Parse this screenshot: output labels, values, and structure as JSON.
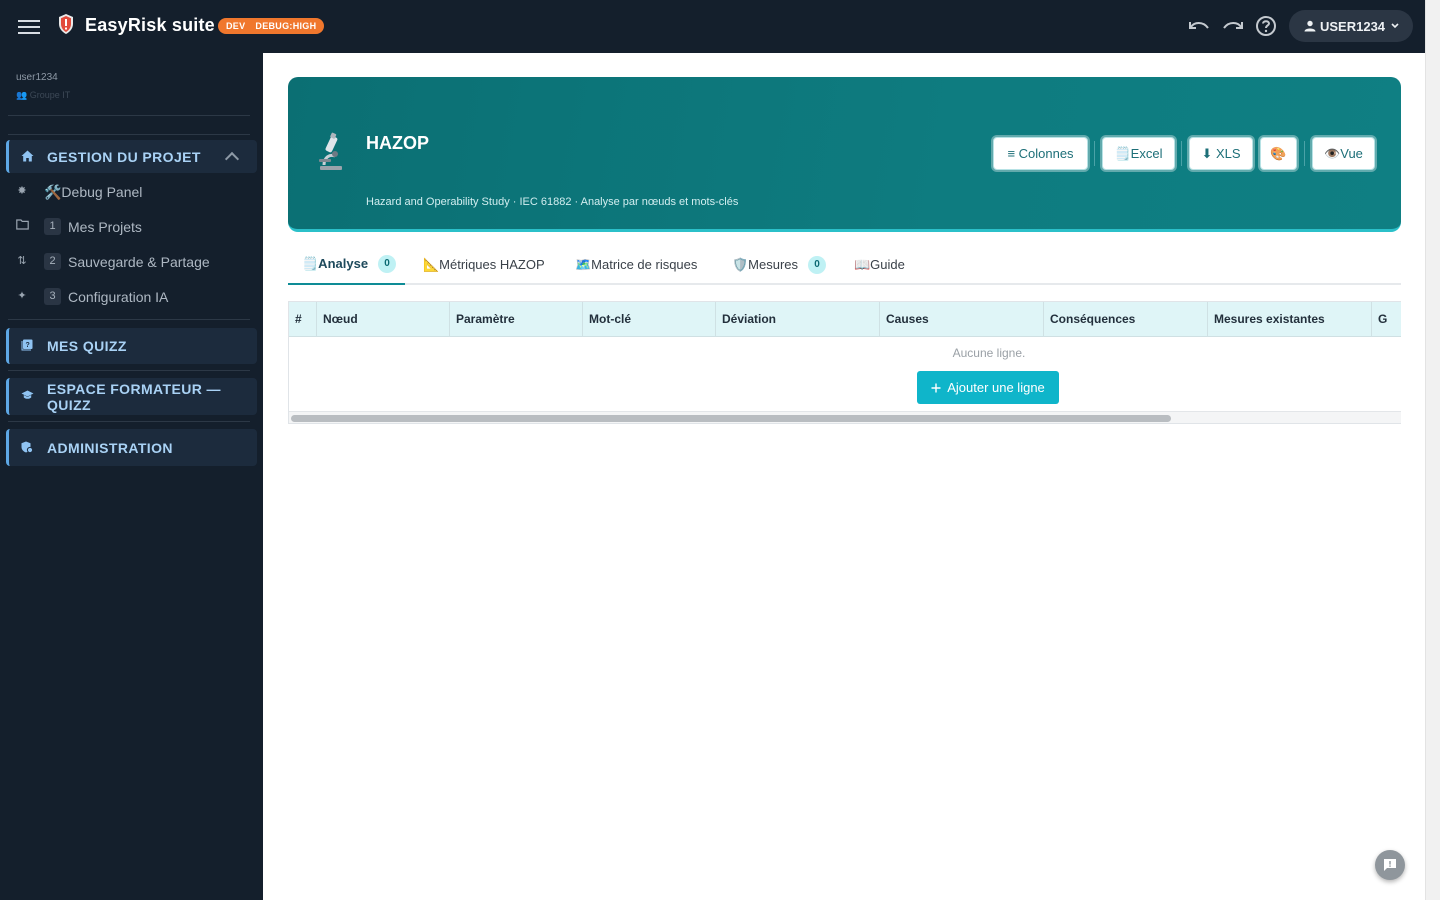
{
  "topbar": {
    "brand": "EasyRisk suite",
    "badge_env": "DEV",
    "badge_debug": "DEBUG:HIGH",
    "user_label": "USER1234",
    "icons": [
      "menu-icon",
      "shield-logo",
      "undo-icon",
      "redo-icon",
      "help-icon",
      "person-icon",
      "chevron-down-icon"
    ]
  },
  "sidebar": {
    "username": "user1234",
    "role": "Groupe IT",
    "sections": [
      {
        "label": "GESTION DU PROJET",
        "icon": "home-icon"
      },
      {
        "label": "MES QUIZZ",
        "icon": "quiz-icon"
      },
      {
        "label": "ESPACE FORMATEUR — QUIZZ",
        "icon": "graduation-cap-icon"
      },
      {
        "label": "ADMINISTRATION",
        "icon": "admin-shield-icon"
      }
    ],
    "items": [
      {
        "label": "🛠️Debug Panel",
        "num": "",
        "icon": "bug-icon"
      },
      {
        "label": "Mes Projets",
        "num": "1",
        "icon": "folder-icon"
      },
      {
        "label": "Sauvegarde & Partage",
        "num": "2",
        "icon": "swap-icon"
      },
      {
        "label": "Configuration IA",
        "num": "3",
        "icon": "sparkle-icon"
      }
    ]
  },
  "hero": {
    "title": "HAZOP",
    "subtitle": "Hazard and Operability Study · IEC 61882 · Analyse par nœuds et mots-clés",
    "buttons": {
      "columns": "≡ Colonnes",
      "excel": "🗒️Excel",
      "xls": "⬇ XLS",
      "palette": "🎨",
      "view": "👁️Vue"
    }
  },
  "tabs": [
    {
      "label": "🗒️Analyse",
      "count": "0"
    },
    {
      "label": "📐Métriques HAZOP",
      "count": ""
    },
    {
      "label": "🗺️Matrice de risques",
      "count": ""
    },
    {
      "label": "🛡️Mesures",
      "count": "0"
    },
    {
      "label": "📖Guide",
      "count": ""
    }
  ],
  "table": {
    "columns": [
      "#",
      "Nœud",
      "Paramètre",
      "Mot-clé",
      "Déviation",
      "Causes",
      "Conséquences",
      "Mesures existantes",
      "G"
    ],
    "empty_text": "Aucune ligne.",
    "add_label": "Ajouter une ligne",
    "add_icon": "plus-icon"
  },
  "fab_icon": "chat-icon"
}
